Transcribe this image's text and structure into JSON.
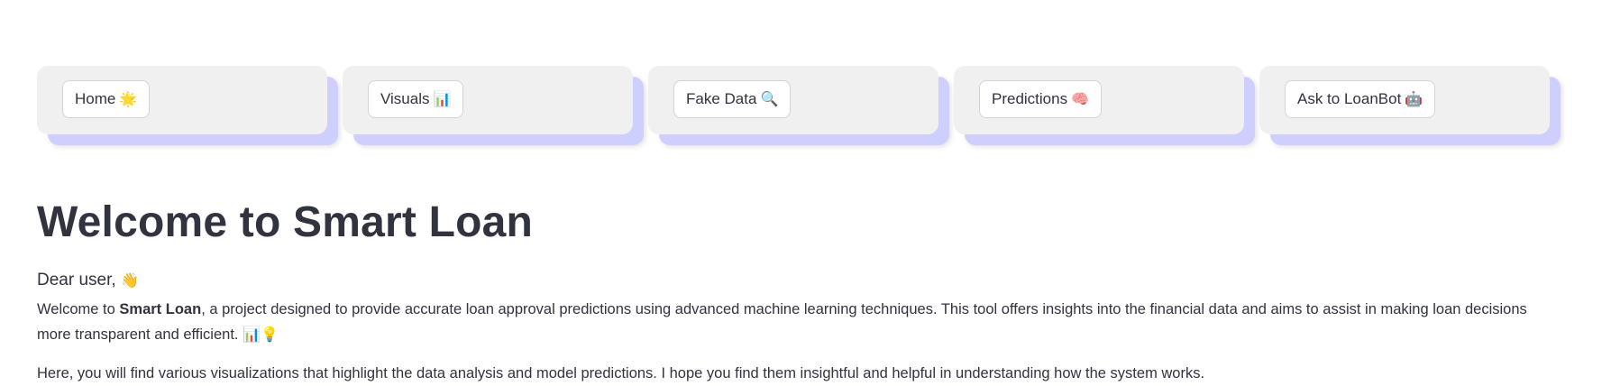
{
  "nav": {
    "items": [
      {
        "label": "Home",
        "icon": "🌟",
        "icon_name": "star-icon"
      },
      {
        "label": "Visuals",
        "icon": "📊",
        "icon_name": "bar-chart-icon"
      },
      {
        "label": "Fake Data",
        "icon": "🔍",
        "icon_name": "magnifier-icon"
      },
      {
        "label": "Predictions",
        "icon": "🧠",
        "icon_name": "brain-icon"
      },
      {
        "label": "Ask to LoanBot",
        "icon": "🤖",
        "icon_name": "robot-icon"
      }
    ]
  },
  "main": {
    "title": "Welcome to Smart Loan",
    "greeting": "Dear user,",
    "greeting_icon": "👋",
    "intro_prefix": "Welcome to ",
    "intro_brand": "Smart Loan",
    "intro_rest": ", a project designed to provide accurate loan approval predictions using advanced machine learning techniques. This tool offers insights into the financial data and aims to assist in making loan decisions more transparent and efficient.",
    "intro_icons": "📊💡",
    "second_paragraph": "Here, you will find various visualizations that highlight the data analysis and model predictions. I hope you find them insightful and helpful in understanding how the system works."
  },
  "colors": {
    "card_bg": "#f0f0f0",
    "card_shadow": "#cfcfff",
    "text": "#31333f"
  }
}
